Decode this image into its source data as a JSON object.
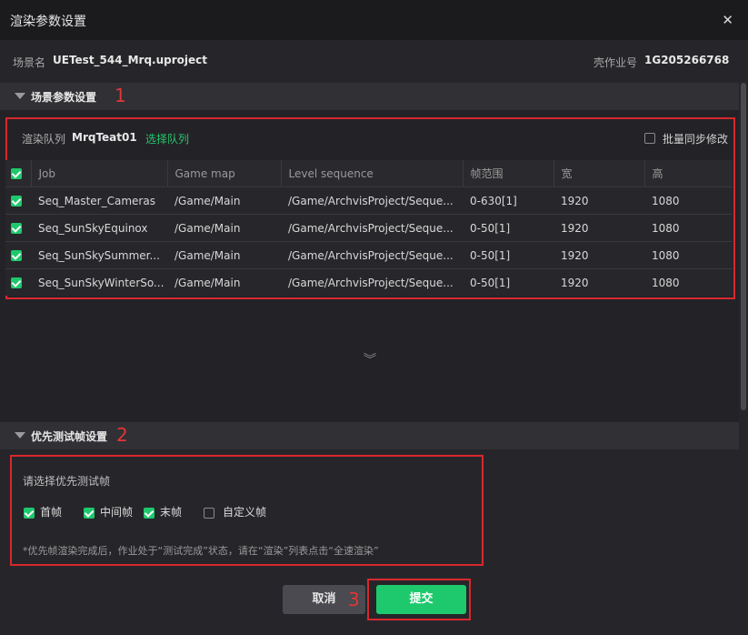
{
  "dialog": {
    "title": "渲染参数设置"
  },
  "meta": {
    "scene_label": "场景名",
    "scene_value": "UETest_544_Mrq.uproject",
    "job_label": "壳作业号",
    "job_value": "1G205266768"
  },
  "section1": {
    "title": "场景参数设置",
    "marker": "1"
  },
  "queue": {
    "label": "渲染队列",
    "name": "MrqTeat01",
    "select_link": "选择队列",
    "batch_label": "批量同步修改"
  },
  "table": {
    "columns": [
      "Job",
      "Game map",
      "Level sequence",
      "帧范围",
      "宽",
      "高"
    ],
    "rows": [
      {
        "job": "Seq_Master_Cameras",
        "map": "/Game/Main",
        "seq": "/Game/ArchvisProject/Seque...",
        "range": "0-630[1]",
        "w": "1920",
        "h": "1080"
      },
      {
        "job": "Seq_SunSkyEquinox",
        "map": "/Game/Main",
        "seq": "/Game/ArchvisProject/Seque...",
        "range": "0-50[1]",
        "w": "1920",
        "h": "1080"
      },
      {
        "job": "Seq_SunSkySummer...",
        "map": "/Game/Main",
        "seq": "/Game/ArchvisProject/Seque...",
        "range": "0-50[1]",
        "w": "1920",
        "h": "1080"
      },
      {
        "job": "Seq_SunSkyWinterSo...",
        "map": "/Game/Main",
        "seq": "/Game/ArchvisProject/Seque...",
        "range": "0-50[1]",
        "w": "1920",
        "h": "1080"
      }
    ]
  },
  "section2": {
    "title": "优先测试帧设置",
    "marker": "2"
  },
  "priority": {
    "prompt": "请选择优先测试帧",
    "options": [
      {
        "label": "首帧",
        "checked": true
      },
      {
        "label": "中间帧",
        "checked": true
      },
      {
        "label": "末帧",
        "checked": true
      },
      {
        "label": "自定义帧",
        "checked": false
      }
    ],
    "note": "*优先帧渲染完成后，作业处于“测试完成”状态，请在“渲染”列表点击“全速渲染”"
  },
  "actions": {
    "cancel": "取消",
    "submit": "提交",
    "marker": "3"
  },
  "colors": {
    "accent": "#1ec96d",
    "highlight_box": "#d8282e"
  }
}
